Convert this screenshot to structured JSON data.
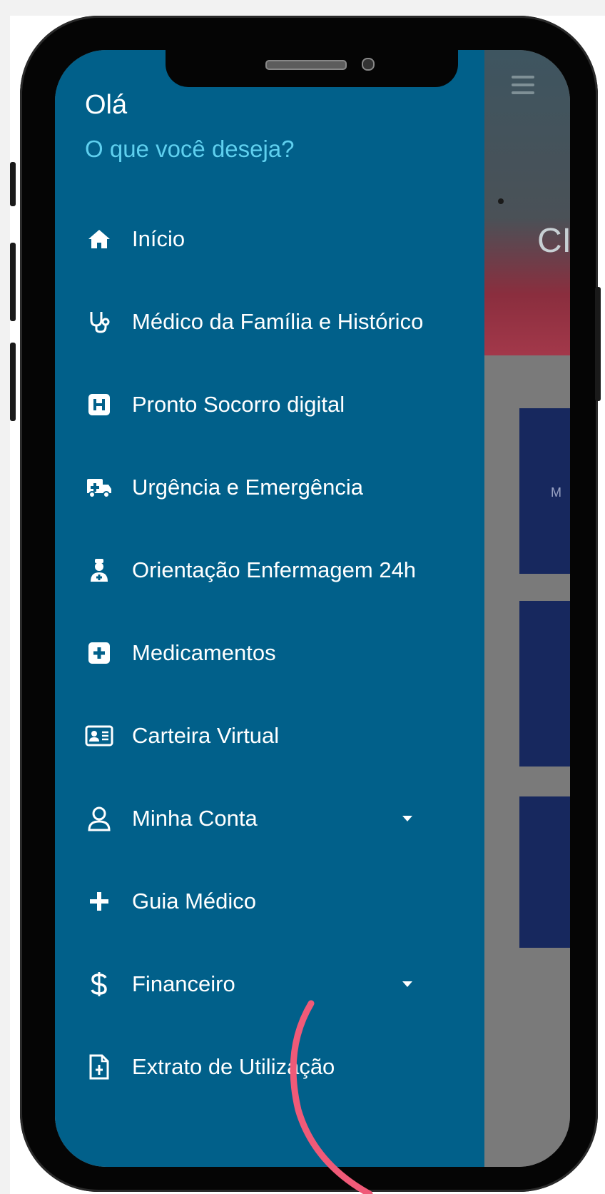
{
  "drawer": {
    "greeting": "Olá",
    "subtitle": "O que você deseja?",
    "items": [
      {
        "label": "Início",
        "icon": "home-icon"
      },
      {
        "label": "Médico da Família e Histórico",
        "icon": "stethoscope-icon"
      },
      {
        "label": "Pronto Socorro digital",
        "icon": "hospital-icon"
      },
      {
        "label": "Urgência e Emergência",
        "icon": "ambulance-icon"
      },
      {
        "label": "Orientação Enfermagem 24h",
        "icon": "nurse-icon"
      },
      {
        "label": "Medicamentos",
        "icon": "medical-kit-icon"
      },
      {
        "label": "Carteira Virtual",
        "icon": "id-card-icon"
      },
      {
        "label": "Minha Conta",
        "icon": "user-icon",
        "expandable": true
      },
      {
        "label": "Guia Médico",
        "icon": "plus-icon"
      },
      {
        "label": "Financeiro",
        "icon": "dollar-icon",
        "expandable": true
      },
      {
        "label": "Extrato de Utilização",
        "icon": "document-icon"
      }
    ]
  },
  "background_app": {
    "header_fragment": "CI",
    "card_fragment": "M"
  },
  "colors": {
    "drawer": "#01608a",
    "subtitle": "#5fd0ef",
    "swoosh": "#f05a78",
    "card": "#17285e"
  }
}
